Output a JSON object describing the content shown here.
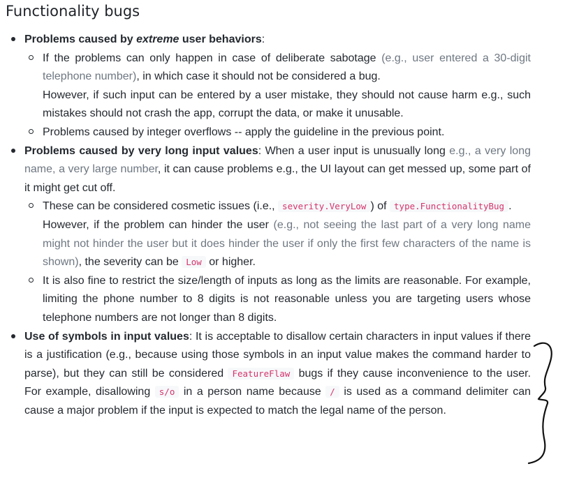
{
  "heading": "Functionality bugs",
  "items": [
    {
      "title_pre": "Problems caused by ",
      "title_em": "extreme",
      "title_post": " user behaviors",
      "colon": ":",
      "subitems": [
        {
          "t1": "If the problems can only happen in case of deliberate sabotage ",
          "t2_gray": "(e.g., user entered a 30-digit telephone number)",
          "t3": ", in which case it should not be considered a bug.",
          "p2": "However, if such input can be entered by a user mistake, they should not cause harm e.g., such mistakes should not crash the app, corrupt the data, or make it unusable."
        },
        {
          "text": "Problems caused by integer overflows -- apply the guideline in the previous point."
        }
      ]
    },
    {
      "title": "Problems caused by very long input values",
      "t1": ": When a user input is unusually long ",
      "t2_gray": "e.g., a very long name, a very large number",
      "t3": ", it can cause problems e.g., the UI layout can get messed up, some part of it might get cut off.",
      "subitems": [
        {
          "t1": "These can be considered cosmetic issues (i.e., ",
          "code1": "severity.VeryLow",
          "t2": ") of ",
          "code2": "type.FunctionalityBug",
          "t3": ".",
          "p2a": "However, if the problem can hinder the user ",
          "p2b_gray": "(e.g., not seeing the last part of a very long name might not hinder the user but it does hinder the user if only the first few characters of the name is shown)",
          "p2c": ", the severity can be ",
          "code3": "Low",
          "p2d": " or higher."
        },
        {
          "text": "It is also fine to restrict the size/length of inputs as long as the limits are reasonable. For example, limiting the phone number to 8 digits is not reasonable unless you are targeting users whose telephone numbers are not longer than 8 digits."
        }
      ]
    },
    {
      "title": "Use of symbols in input values",
      "t1": ": It is acceptable to disallow certain characters in input values if there is a justification (e.g., because using those symbols in an input value makes the command harder to parse), but they can still be considered ",
      "code1": "FeatureFlaw",
      "t2": " bugs if they cause inconvenience to the user. For example, disallowing ",
      "code2": "s/o",
      "t3": " in a person name because ",
      "code3": "/",
      "t4": " is used as a command delimiter can cause a major problem if the input is expected to match the legal name of the person."
    }
  ],
  "annotation": "hand-drawn-curly-brace"
}
